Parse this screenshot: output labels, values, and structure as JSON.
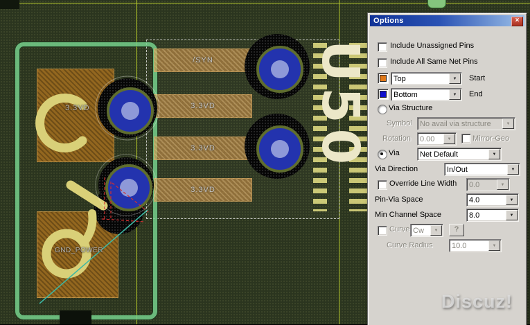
{
  "icons": {
    "dropdown_arrow": "▼",
    "close": "×",
    "help": "?"
  },
  "colors": {
    "start_swatch": "#e07818",
    "end_swatch": "#1010cc"
  },
  "pcb": {
    "pad_labels": [
      "/SYN",
      "3.3VD",
      "3.3VD",
      "3.3VD"
    ],
    "big_pad_label": "3.3VD",
    "gnd_label": "GND_POWER",
    "refdes": "U50",
    "watermark": "Discuz!"
  },
  "dialog": {
    "title": "Options",
    "include_unassigned": "Include Unassigned Pins",
    "include_same_net": "Include All Same Net Pins",
    "start_value": "Top",
    "start_label": "Start",
    "end_value": "Bottom",
    "end_label": "End",
    "via_structure_label": "Via Structure",
    "symbol_label": "Symbol",
    "symbol_value": "No avail via structure",
    "rotation_label": "Rotation",
    "rotation_value": "0.00",
    "mirror_geo_label": "Mirror-Geo",
    "via_label": "Via",
    "via_value": "Net Default",
    "via_direction_label": "Via Direction",
    "via_direction_value": "In/Out",
    "override_label": "Override Line Width",
    "override_value": "0.0",
    "pin_via_label": "Pin-Via Space",
    "pin_via_value": "4.0",
    "min_channel_label": "Min Channel Space",
    "min_channel_value": "8.0",
    "curve_label": "Curve",
    "curve_value": "Cw",
    "curve_radius_label": "Curve Radius",
    "curve_radius_value": "10.0"
  }
}
